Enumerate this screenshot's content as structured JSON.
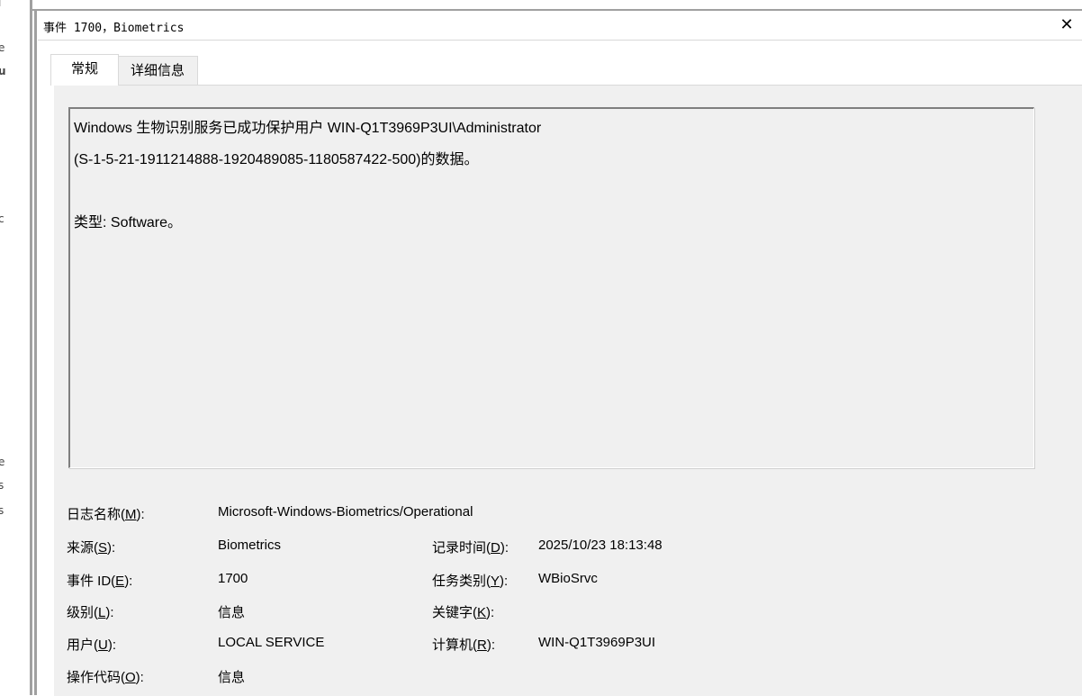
{
  "background_window": {
    "fragments": [
      "l",
      "e",
      "u",
      "c",
      "e",
      "s",
      "s"
    ]
  },
  "dialog": {
    "title": "事件 1700，Biometrics",
    "close_icon": "close-icon"
  },
  "tabs": [
    {
      "label": "常规",
      "active": true
    },
    {
      "label": "详细信息",
      "active": false
    }
  ],
  "description": {
    "line1": "Windows 生物识别服务已成功保护用户 WIN-Q1T3969P3UI\\Administrator",
    "line2": "(S-1-5-21-1911214888-1920489085-1180587422-500)的数据。",
    "line3": "类型: Software。"
  },
  "fields": {
    "log_name": {
      "label_pre": "日志名称(",
      "label_key": "M",
      "label_post": "):",
      "value": "Microsoft-Windows-Biometrics/Operational"
    },
    "source": {
      "label_pre": "来源(",
      "label_key": "S",
      "label_post": "):",
      "value": "Biometrics"
    },
    "logged": {
      "label_pre": "记录时间(",
      "label_key": "D",
      "label_post": "):",
      "value": "2025/10/23 18:13:48"
    },
    "event_id": {
      "label_pre": "事件 ID(",
      "label_key": "E",
      "label_post": "):",
      "value": "1700"
    },
    "task_category": {
      "label_pre": "任务类别(",
      "label_key": "Y",
      "label_post": "):",
      "value": "WBioSrvc"
    },
    "level": {
      "label_pre": "级别(",
      "label_key": "L",
      "label_post": "):",
      "value": "信息"
    },
    "keywords": {
      "label_pre": "关键字(",
      "label_key": "K",
      "label_post": "):",
      "value": ""
    },
    "user": {
      "label_pre": "用户(",
      "label_key": "U",
      "label_post": "):",
      "value": "LOCAL SERVICE"
    },
    "computer": {
      "label_pre": "计算机(",
      "label_key": "R",
      "label_post": "):",
      "value": "WIN-Q1T3969P3UI"
    },
    "opcode": {
      "label_pre": "操作代码(",
      "label_key": "O",
      "label_post": "):",
      "value": "信息"
    }
  },
  "colors": {
    "panel_bg": "#f0f0f0",
    "frame": "#a0a0a0"
  }
}
